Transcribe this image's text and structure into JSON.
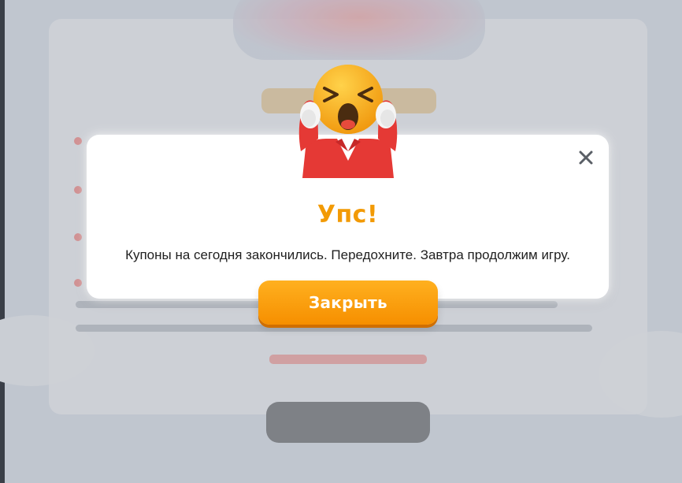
{
  "modal": {
    "title": "Упс!",
    "message": "Купоны на сегодня закончились. Передохните. Завтра продолжим игру.",
    "close_icon": "close-icon",
    "illustration_icon": "crying-emoji-icon"
  },
  "actions": {
    "close_label": "Закрыть"
  },
  "colors": {
    "accent": "#f29a05",
    "button": "#f68f00",
    "overlay": "#dde3ec"
  }
}
